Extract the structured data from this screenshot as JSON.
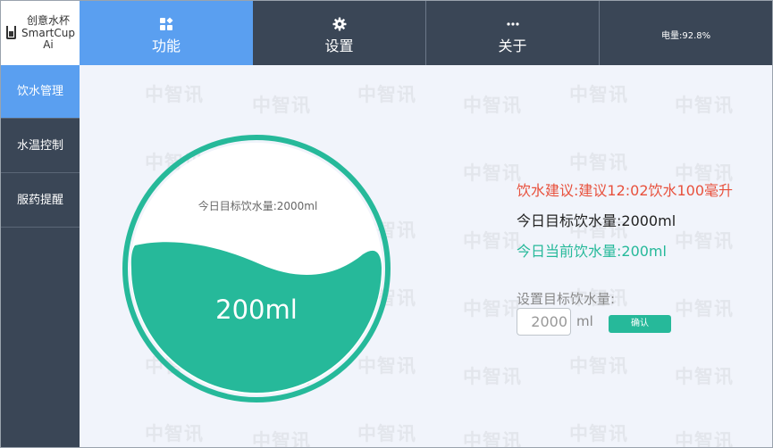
{
  "app": {
    "name_cn": "创意水杯",
    "name_en_line1": "SmartCup",
    "name_en_line2": "Ai",
    "logo_icon": "cup-icon"
  },
  "header": {
    "tabs": [
      {
        "label": "功能",
        "icon": "apps-grid-icon",
        "active": true
      },
      {
        "label": "设置",
        "icon": "gear-icon",
        "active": false
      },
      {
        "label": "关于",
        "icon": "ellipsis-icon",
        "active": false
      }
    ],
    "battery": "电量:92.8%"
  },
  "sidebar": {
    "items": [
      {
        "label": "饮水管理",
        "active": true
      },
      {
        "label": "水温控制",
        "active": false
      },
      {
        "label": "服药提醒",
        "active": false
      }
    ]
  },
  "main": {
    "watermark": "中智讯",
    "cup": {
      "target_label": "今日目标饮水量:2000ml",
      "current_value": "200ml"
    },
    "info": {
      "suggestion": "饮水建议:建议12:02饮水100毫升",
      "target": "今日目标饮水量:2000ml",
      "current": "今日当前饮水量:200ml"
    },
    "set_target": {
      "label": "设置目标饮水量:",
      "input_value": "2000",
      "unit": "ml",
      "confirm_label": "确认"
    }
  },
  "colors": {
    "topbar_bg": "#3a4656",
    "active_blue": "#5a9ff0",
    "teal": "#26b99a",
    "suggestion_red": "#e8513d",
    "main_bg": "#f1f4fb"
  }
}
